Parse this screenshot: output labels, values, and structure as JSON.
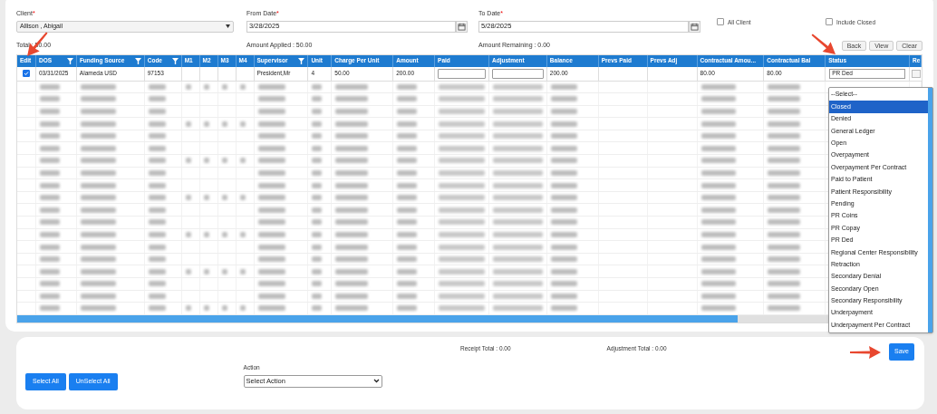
{
  "filters": {
    "client": {
      "label": "Client",
      "required_mark": "*",
      "value": "Allison , Abigail"
    },
    "from_date": {
      "label": "From Date",
      "required_mark": "*",
      "value": "3/28/2025"
    },
    "to_date": {
      "label": "To Date",
      "required_mark": "*",
      "value": "5/28/2025"
    },
    "checkboxes": [
      {
        "label": "All Client",
        "checked": false
      },
      {
        "label": "Include Closed",
        "checked": false
      }
    ]
  },
  "summary": {
    "total": "Total : 50.00",
    "amount_applied": "Amount Applied : 50.00",
    "amount_remaining": "Amount Remaining : 0.00"
  },
  "top_buttons": [
    "Back",
    "View",
    "Clear"
  ],
  "table": {
    "columns": [
      {
        "label": "Edit",
        "filter": false
      },
      {
        "label": "DOS",
        "filter": true
      },
      {
        "label": "Funding Source",
        "filter": true
      },
      {
        "label": "Code",
        "filter": true
      },
      {
        "label": "M1",
        "filter": false
      },
      {
        "label": "M2",
        "filter": false
      },
      {
        "label": "M3",
        "filter": false
      },
      {
        "label": "M4",
        "filter": false
      },
      {
        "label": "Supervisor",
        "filter": true
      },
      {
        "label": "Unit",
        "filter": false
      },
      {
        "label": "Charge Per Unit",
        "filter": false
      },
      {
        "label": "Amount",
        "filter": false
      },
      {
        "label": "Paid",
        "filter": false
      },
      {
        "label": "Adjustment",
        "filter": false
      },
      {
        "label": "Balance",
        "filter": false
      },
      {
        "label": "Prevs Paid",
        "filter": false
      },
      {
        "label": "Prevs Adj",
        "filter": false
      },
      {
        "label": "Contractual Amou...",
        "filter": false
      },
      {
        "label": "Contractual Bal",
        "filter": false
      },
      {
        "label": "Status",
        "filter": false
      },
      {
        "label": "Re",
        "filter": false
      }
    ],
    "rows": [
      {
        "kind": "data",
        "checked": true,
        "dos": "03/31/2025",
        "funding_source": "Alameda USD",
        "code": "97153",
        "supervisor": "President,Mr",
        "unit": "4",
        "charge_per_unit": "50.00",
        "amount": "200.00",
        "balance": "200.00",
        "contractual_amount": "80.00",
        "contractual_bal": "80.00",
        "status": "PR Ded"
      },
      {
        "kind": "redacted"
      },
      {
        "kind": "redacted"
      },
      {
        "kind": "redacted"
      },
      {
        "kind": "redacted"
      },
      {
        "kind": "redacted"
      },
      {
        "kind": "redacted"
      },
      {
        "kind": "redacted"
      },
      {
        "kind": "redacted"
      },
      {
        "kind": "redacted"
      },
      {
        "kind": "redacted"
      },
      {
        "kind": "redacted"
      },
      {
        "kind": "redacted"
      },
      {
        "kind": "redacted"
      },
      {
        "kind": "redacted"
      },
      {
        "kind": "redacted"
      },
      {
        "kind": "redacted"
      },
      {
        "kind": "redacted"
      },
      {
        "kind": "redacted"
      },
      {
        "kind": "redacted"
      }
    ]
  },
  "status_dropdown": [
    {
      "label": "--Select--",
      "selected": false
    },
    {
      "label": "Closed",
      "selected": true
    },
    {
      "label": "Denied",
      "selected": false
    },
    {
      "label": "General Ledger",
      "selected": false
    },
    {
      "label": "Open",
      "selected": false
    },
    {
      "label": "Overpayment",
      "selected": false
    },
    {
      "label": "Overpayment Per Contract",
      "selected": false
    },
    {
      "label": "Paid to Patient",
      "selected": false
    },
    {
      "label": "Patient Responsibility",
      "selected": false
    },
    {
      "label": "Pending",
      "selected": false
    },
    {
      "label": "PR Coins",
      "selected": false
    },
    {
      "label": "PR Copay",
      "selected": false
    },
    {
      "label": "PR Ded",
      "selected": false
    },
    {
      "label": "Regional Center Responsibility",
      "selected": false
    },
    {
      "label": "Retraction",
      "selected": false
    },
    {
      "label": "Secondary Denial",
      "selected": false
    },
    {
      "label": "Secondary Open",
      "selected": false
    },
    {
      "label": "Secondary Responsibility",
      "selected": false
    },
    {
      "label": "Underpayment",
      "selected": false
    },
    {
      "label": "Underpayment Per Contract",
      "selected": false
    }
  ],
  "footer": {
    "receipt_total": "Receipt Total : 0.00",
    "adjustment_total": "Adjustment Total : 0.00",
    "save": "Save",
    "select_all": "Select All",
    "unselect_all": "UnSelect All",
    "action_label": "Action",
    "action_value": "Select Action"
  }
}
